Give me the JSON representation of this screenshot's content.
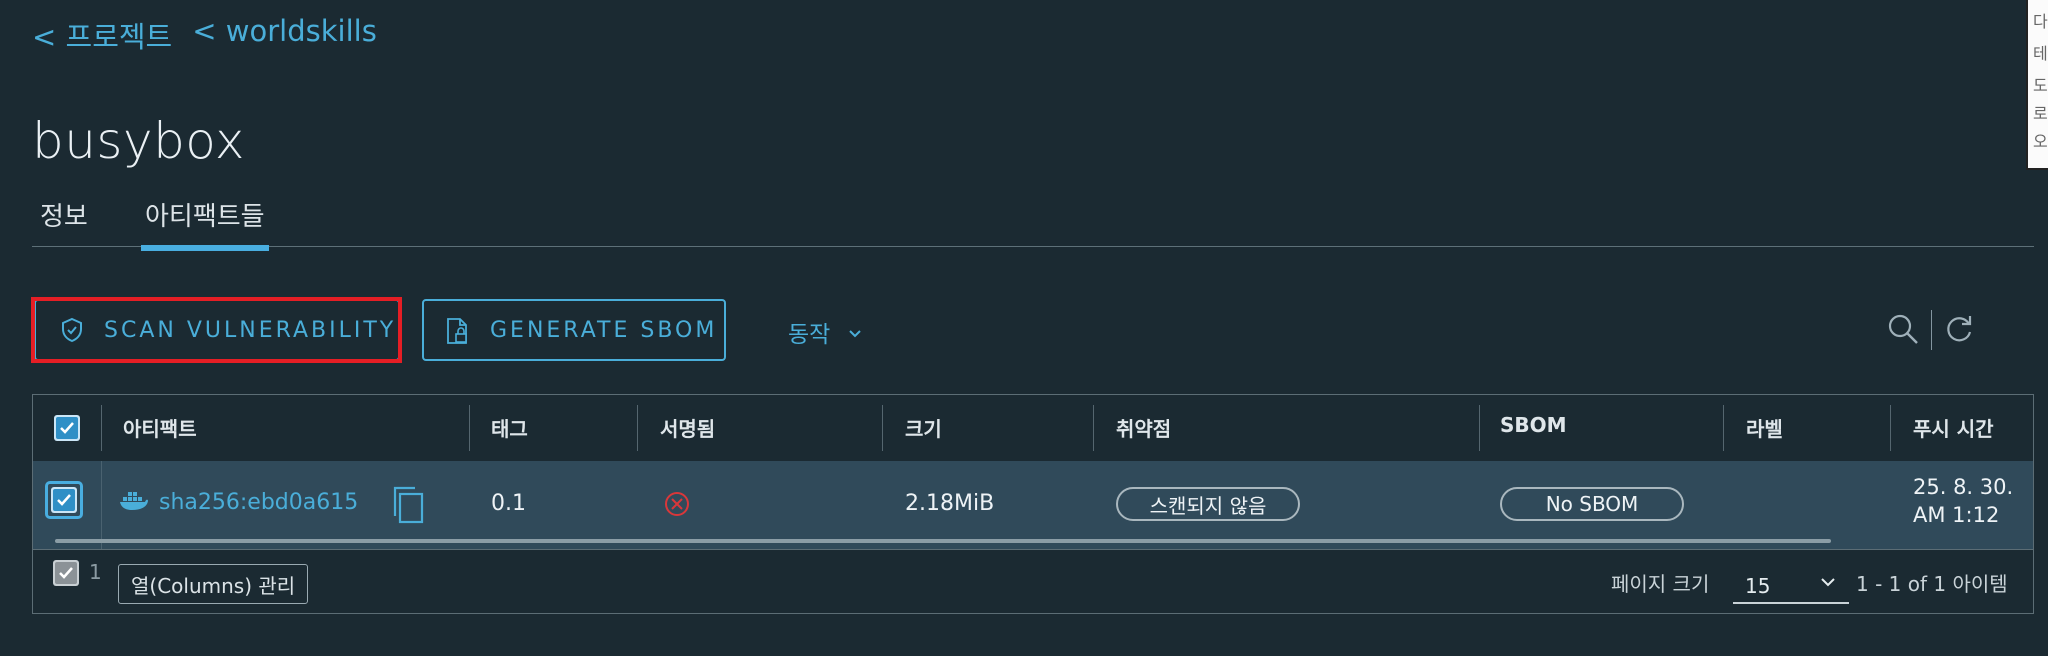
{
  "breadcrumb": [
    "< 프로젝트",
    "< worldskills"
  ],
  "page_title": "busybox",
  "tabs": [
    "정보",
    "아티팩트들"
  ],
  "active_tab": "아티팩트들",
  "toolbar": {
    "scan_label": "SCAN VULNERABILITY",
    "sbom_label": "GENERATE SBOM",
    "actions_label": "동작",
    "scan_icon": "shield-icon",
    "sbom_icon": "document-lock-icon",
    "search_icon": "search-icon",
    "refresh_icon": "refresh-icon"
  },
  "table": {
    "columns": [
      "아티팩트",
      "태그",
      "서명됨",
      "크기",
      "취약점",
      "SBOM",
      "라벨",
      "푸시 시간"
    ],
    "rows": [
      {
        "artifact": "sha256:ebd0a615",
        "tag": "0.1",
        "signed_icon": "x-circle-icon",
        "size": "2.18MiB",
        "vulnerability": "스캔되지 않음",
        "sbom": "No SBOM",
        "label": "",
        "push_time_line1": "25. 8. 30.",
        "push_time_line2": "AM 1:12"
      }
    ]
  },
  "footer": {
    "selected_count": "1",
    "columns_button": "열(Columns) 관리",
    "page_size_label": "페이지 크기",
    "page_size": "15",
    "range": "1 - 1 of 1 아이템"
  },
  "side_widget_chars": [
    "다",
    "테",
    "도",
    "로",
    "오"
  ],
  "colors": {
    "accent": "#4aaed9",
    "background": "#1b2a32",
    "row_selected": "#304a5a",
    "highlight": "#e51e25",
    "error": "#d9373a"
  }
}
